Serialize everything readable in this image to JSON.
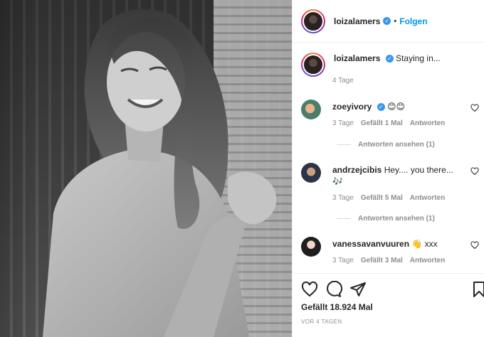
{
  "post": {
    "author": "loizalamers",
    "verified_glyph": "✓",
    "separator": "•",
    "follow_label": "Folgen",
    "caption": "Staying in...",
    "caption_time": "4 Tage",
    "likes_text": "Gefällt 18.924 Mal",
    "posted_ago": "VOR 4 TAGEN"
  },
  "comments": [
    {
      "user": "zoeyivory",
      "verified": true,
      "text": "😊😊",
      "time": "3 Tage",
      "likes": "Gefällt 1 Mal",
      "reply": "Antworten",
      "view_replies": "Antworten ansehen (1)"
    },
    {
      "user": "andrzejcibis",
      "verified": false,
      "text": "Hey.... you there...",
      "text2": "🎶",
      "time": "3 Tage",
      "likes": "Gefällt 5 Mal",
      "reply": "Antworten",
      "view_replies": "Antworten ansehen (1)"
    },
    {
      "user": "vanessavanvuuren",
      "verified": false,
      "text": "👋 xxx",
      "time": "3 Tage",
      "likes": "Gefällt 3 Mal",
      "reply": "Antworten"
    }
  ],
  "icons": {
    "like": "heart-icon",
    "comment": "comment-icon",
    "share": "paper-plane-icon",
    "save": "bookmark-icon"
  },
  "colors": {
    "link_blue": "#0095f6",
    "verified_blue": "#3897f0",
    "muted": "#8e8e8e"
  }
}
